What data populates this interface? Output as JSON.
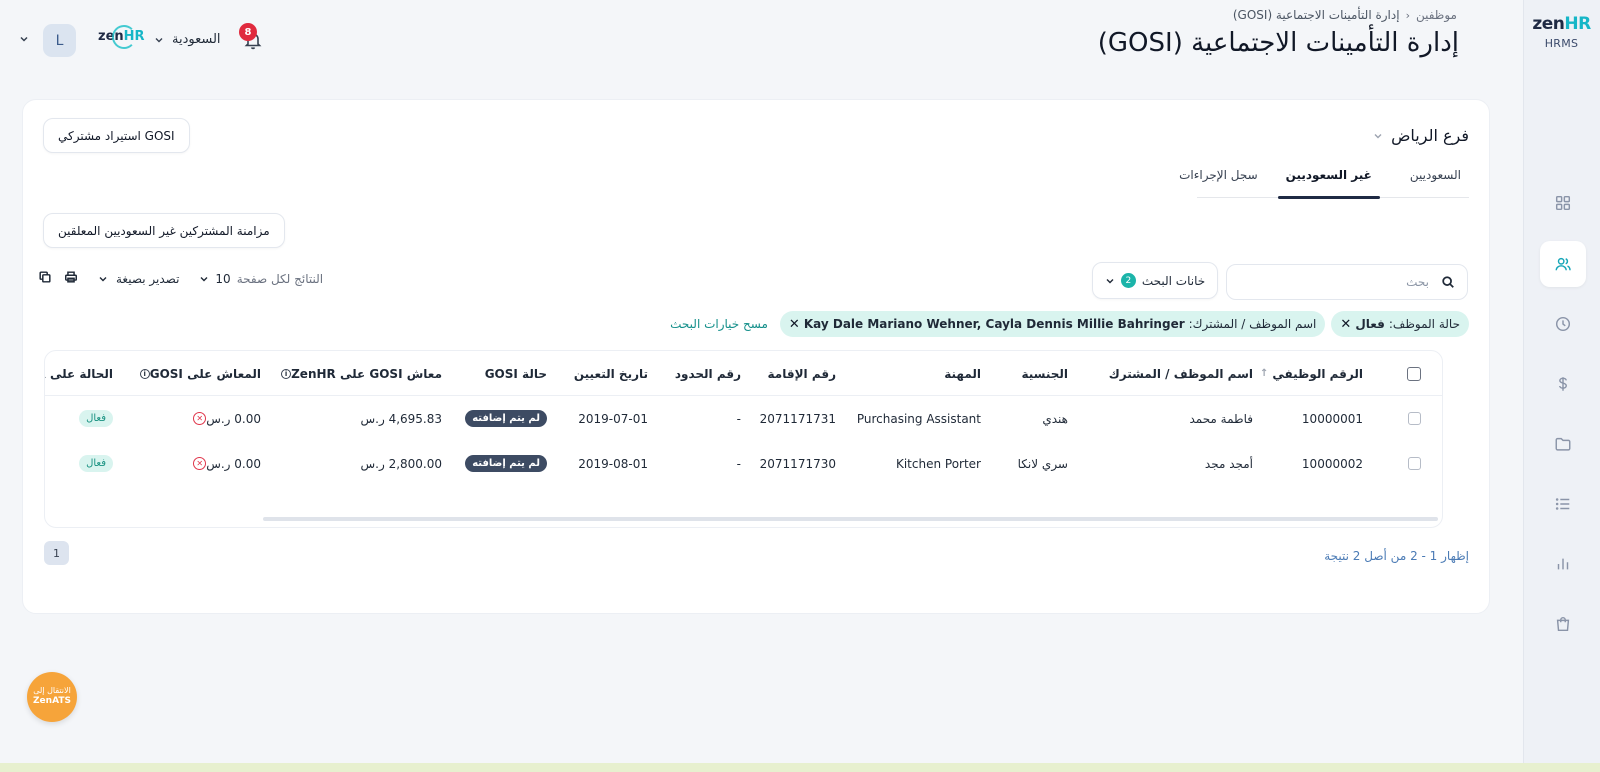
{
  "app": {
    "brand_zen": "zen",
    "brand_hr": "HR",
    "brand_sub": "HRMS"
  },
  "header": {
    "breadcrumb": [
      "موظفين",
      "إدارة التأمينات الاجتماعية (GOSI)"
    ],
    "title": "إدارة التأمينات الاجتماعية (GOSI)",
    "avatar_initial": "L",
    "company_logo_zen": "zen",
    "company_logo_hr": "HR",
    "country": "السعودية",
    "notifications_count": "8"
  },
  "sidebar": {
    "items": [
      {
        "icon": "grid-icon",
        "active": false
      },
      {
        "icon": "users-icon",
        "active": true
      },
      {
        "icon": "clock-icon",
        "active": false
      },
      {
        "icon": "dollar-icon",
        "active": false
      },
      {
        "icon": "folder-icon",
        "active": false
      },
      {
        "icon": "list-icon",
        "active": false
      },
      {
        "icon": "bar-chart-icon",
        "active": false
      },
      {
        "icon": "bag-icon",
        "active": false
      }
    ]
  },
  "card": {
    "branch": "فرع الرياض",
    "import_button": "استيراد مشتركي GOSI",
    "tabs": [
      {
        "label": "السعوديين",
        "active": false
      },
      {
        "label": "غير السعوديين",
        "active": true
      },
      {
        "label": "سجل الإجراءات",
        "active": false
      }
    ],
    "sync_button": "مزامنة المشتركين غير السعوديين المعلقين",
    "search_placeholder": "بحث",
    "search_fields_label": "خانات البحث",
    "search_fields_count": "2",
    "export_label": "تصدير بصيغة",
    "per_page_label": "النتائج لكل صفحة",
    "per_page_value": "10",
    "filters": [
      {
        "label": "حالة الموظف:",
        "value": "فعال"
      },
      {
        "label": "اسم الموظف / المشترك:",
        "value": "Kay Dale Mariano Wehner, Cayla Dennis Millie Bahringer"
      }
    ],
    "clear_filters": "مسح خيارات البحث"
  },
  "table": {
    "columns": [
      "الرقم الوظيفي",
      "اسم الموظف / المشترك",
      "الجنسية",
      "المهنة",
      "رقم الإقامة",
      "رقم الحدود",
      "تاريخ التعيين",
      "حالة GOSI",
      "معاش GOSI على ZenHR",
      "المعاش على GOSI",
      "الحالة على ZenHR"
    ],
    "rows": [
      {
        "emp_no": "10000001",
        "name": "فاطمة محمد",
        "nationality": "هندي",
        "profession": "Purchasing Assistant",
        "iqama": "2071171731",
        "border": "-",
        "hire_date": "2019-07-01",
        "gosi_status": "لم يتم إضافته",
        "zenhr_salary": "4,695.83 ر.س",
        "gosi_salary": "0.00 ر.س",
        "zenhr_status": "فعال"
      },
      {
        "emp_no": "10000002",
        "name": "أمجد مجد",
        "nationality": "سري لانكا",
        "profession": "Kitchen Porter",
        "iqama": "2071171730",
        "border": "-",
        "hire_date": "2019-08-01",
        "gosi_status": "لم يتم إضافته",
        "zenhr_salary": "2,800.00 ر.س",
        "gosi_salary": "0.00 ر.س",
        "zenhr_status": "فعال"
      }
    ]
  },
  "pagination": {
    "summary": "إظهار 1 - 2 من أصل 2 نتيجة",
    "page": "1"
  },
  "fab": {
    "line1": "الانتقال إلى",
    "line2": "ZenATS"
  },
  "colors": {
    "accent": "#16b6c7",
    "chip_bg": "#d9f4ef",
    "dark_pill": "#3d4b63",
    "error": "#e0364b",
    "fab": "#f6a43a"
  }
}
